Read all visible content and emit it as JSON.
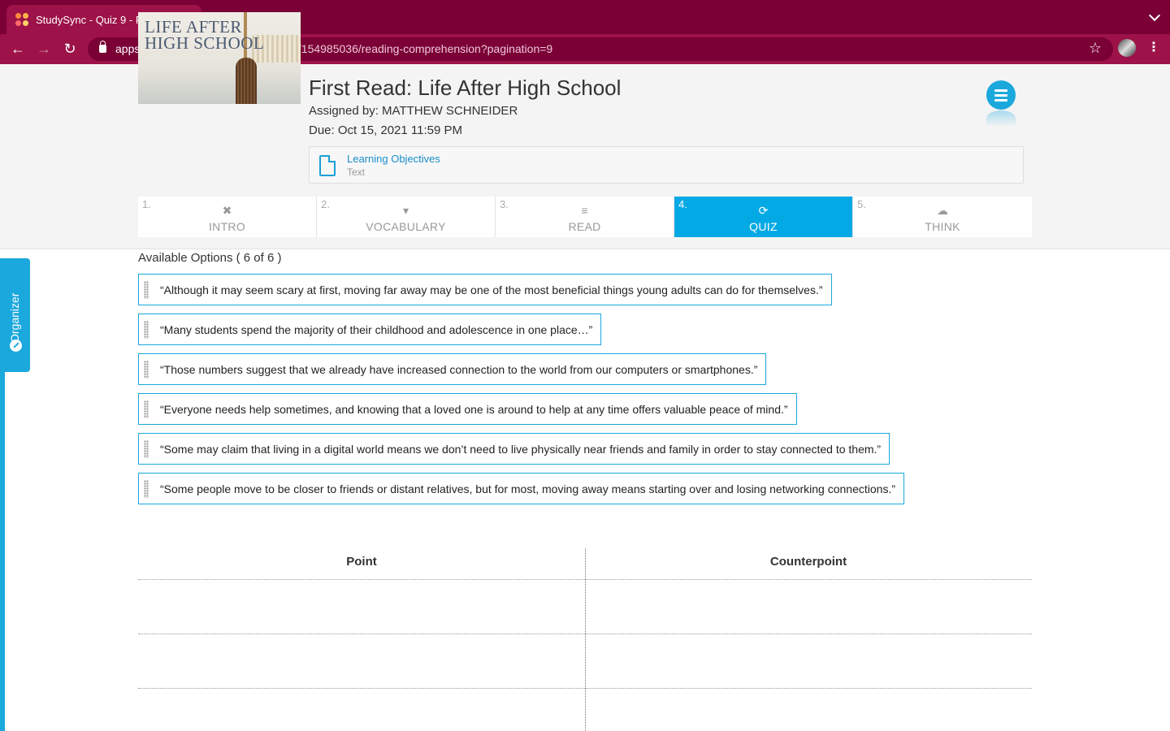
{
  "browser": {
    "tab_title": "StudySync - Quiz 9 - First Rea",
    "tab_close": "✕",
    "new_tab": "+",
    "url_host": "apps.studysync.com",
    "url_path": "/#!/assignments/154985036/reading-comprehension?pagination=9",
    "back": "←",
    "forward": "→",
    "reload": "↻",
    "star": "☆",
    "menu": "⋮"
  },
  "assignment": {
    "title": "First Read: Life After High School",
    "assigned_by": "Assigned by: MATTHEW SCHNEIDER",
    "due": "Due: Oct 15, 2021 11:59 PM",
    "thumbnail_text_line1": "LIFE AFTER",
    "thumbnail_text_line2": "HIGH SCHOOL"
  },
  "objectives": {
    "title": "Learning Objectives",
    "subtitle": "Text"
  },
  "steps": [
    {
      "num": "1.",
      "label": "INTRO",
      "icon": "✖",
      "active": false
    },
    {
      "num": "2.",
      "label": "VOCABULARY",
      "icon": "▾",
      "active": false
    },
    {
      "num": "3.",
      "label": "READ",
      "icon": "≡",
      "active": false
    },
    {
      "num": "4.",
      "label": "QUIZ",
      "icon": "⟳",
      "active": true
    },
    {
      "num": "5.",
      "label": "THINK",
      "icon": "☁",
      "active": false
    }
  ],
  "organizer": {
    "label": "Organizer"
  },
  "options": {
    "heading": "Available Options ( 6 of 6 )",
    "items": [
      "“Although it may seem scary at first, moving far away may be one of the most beneficial things young adults can do for themselves.”",
      "“Many students spend the majority of their childhood and adolescence in one place…”",
      "“Those numbers suggest that we already have increased connection to the world from our computers or smartphones.”",
      "“Everyone needs help sometimes, and knowing that a loved one is around to help at any time offers valuable peace of mind.”",
      "“Some may claim that living in a digital world means we don’t need to live physically near friends and family in order to stay connected to them.”",
      "“Some people move to be closer to friends or distant relatives, but for most, moving away means starting over and losing networking connections.”"
    ]
  },
  "table": {
    "col1": "Point",
    "col2": "Counterpoint"
  },
  "colors": {
    "browser_frame": "#7a0035",
    "accent": "#1aa8dd",
    "active_step": "#03a9e4"
  }
}
